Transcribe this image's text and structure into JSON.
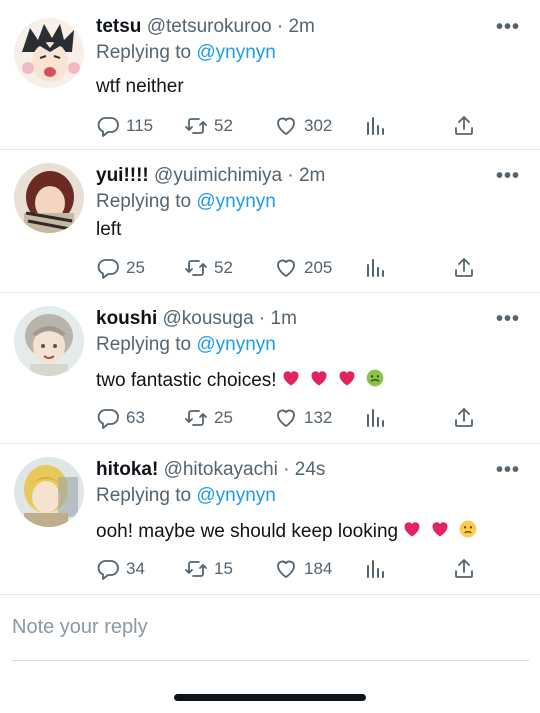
{
  "tweets": [
    {
      "name": "tetsu",
      "handle": "@tetsurokuroo",
      "time": "· 2m",
      "replying_prefix": "Replying to ",
      "replying_to": "@ynynyn",
      "text": "wtf neither",
      "emojis": [],
      "replies": "115",
      "retweets": "52",
      "likes": "302"
    },
    {
      "name": "yui!!!!",
      "handle": "@yuimichimiya",
      "time": "· 2m",
      "replying_prefix": "Replying to ",
      "replying_to": "@ynynyn",
      "text": "left",
      "emojis": [],
      "replies": "25",
      "retweets": "52",
      "likes": "205"
    },
    {
      "name": "koushi",
      "handle": "@kousuga",
      "time": "· 1m",
      "replying_prefix": "Replying to ",
      "replying_to": "@ynynyn",
      "text": "two fantastic choices!",
      "emojis": [
        "red-heart",
        "red-heart",
        "red-heart",
        "nauseated-face"
      ],
      "replies": "63",
      "retweets": "25",
      "likes": "132"
    },
    {
      "name": "hitoka!",
      "handle": "@hitokayachi",
      "time": "· 24s",
      "replying_prefix": "Replying to ",
      "replying_to": "@ynynyn",
      "text": "ooh! maybe we should keep looking",
      "emojis": [
        "red-heart",
        "red-heart",
        "slightly-frowning-face"
      ],
      "replies": "34",
      "retweets": "15",
      "likes": "184"
    }
  ],
  "more_label": "•••",
  "composer": {
    "placeholder": "Note your reply"
  },
  "colors": {
    "link": "#1d9bf0",
    "muted": "#536471",
    "heart_red": "#e0245e"
  },
  "icons": [
    "reply-icon",
    "retweet-icon",
    "like-icon",
    "stats-icon",
    "share-icon",
    "more-icon"
  ]
}
